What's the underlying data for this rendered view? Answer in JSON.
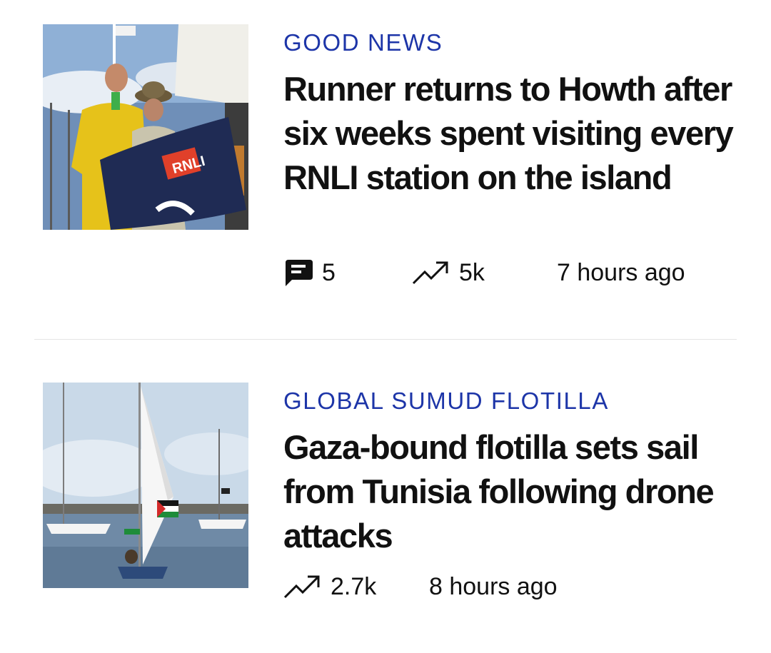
{
  "articles": [
    {
      "kicker": "GOOD NEWS",
      "headline": "Runner returns to Howth after six weeks spent visiting every RNLI station on the island",
      "comments": "5",
      "views": "5k",
      "time": "7 hours ago",
      "thumbnail_text": "RNLI"
    },
    {
      "kicker": "GLOBAL SUMUD FLOTILLA",
      "headline": "Gaza-bound flotilla sets sail from Tunisia following drone attacks",
      "views": "2.7k",
      "time": "8 hours ago"
    }
  ],
  "icons": {
    "comments": "comment-icon",
    "views": "trending-icon"
  },
  "colors": {
    "kicker": "#1d35a8",
    "text": "#111111",
    "divider": "#e4e4e4",
    "background": "#ffffff"
  }
}
